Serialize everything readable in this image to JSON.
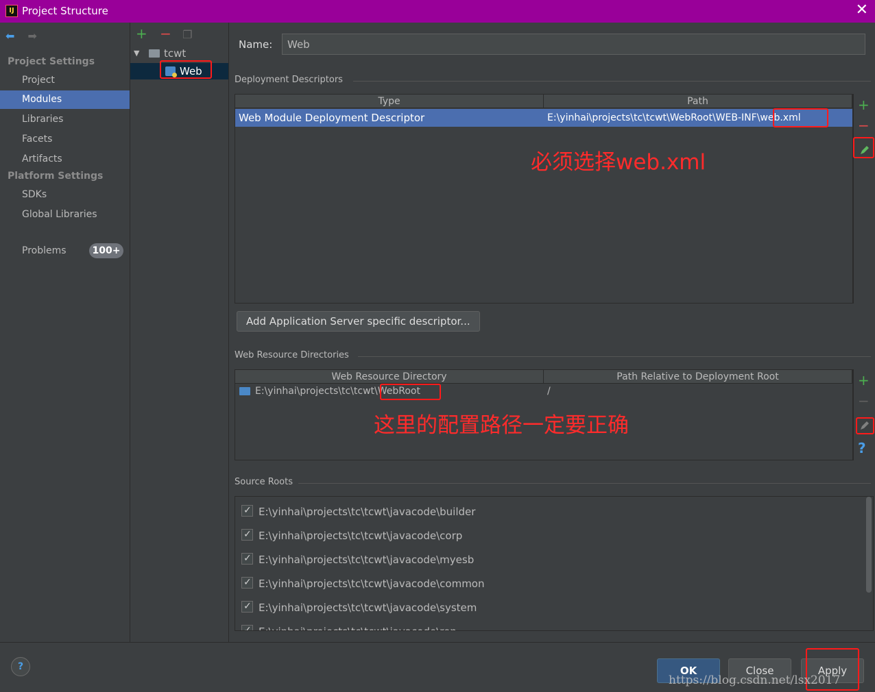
{
  "window": {
    "title": "Project Structure",
    "close": "✕"
  },
  "sidebar": {
    "back": "⬅",
    "forward": "➡",
    "project_settings_label": "Project Settings",
    "project_items": [
      "Project",
      "Modules",
      "Libraries",
      "Facets",
      "Artifacts"
    ],
    "platform_settings_label": "Platform Settings",
    "platform_items": [
      "SDKs",
      "Global Libraries"
    ],
    "problems_label": "Problems",
    "problems_badge": "100+"
  },
  "tree": {
    "root": "tcwt",
    "child": "Web"
  },
  "module": {
    "name_label": "Name:",
    "name_value": "Web",
    "deployment": {
      "title": "Deployment Descriptors",
      "col_type": "Type",
      "col_path": "Path",
      "row_type": "Web Module Deployment Descriptor",
      "row_path": "E:\\yinhai\\projects\\tc\\tcwt\\WebRoot\\WEB-INF\\web.xml",
      "annotation": "必须选择web.xml",
      "add_button": "Add Application Server specific descriptor..."
    },
    "web_resources": {
      "title": "Web Resource Directories",
      "col_dir": "Web Resource Directory",
      "col_rel": "Path Relative to Deployment Root",
      "row_dir": "E:\\yinhai\\projects\\tc\\tcwt\\WebRoot",
      "row_rel": "/",
      "annotation": "这里的配置路径一定要正确",
      "help": "?"
    },
    "source_roots": {
      "title": "Source Roots",
      "items": [
        "E:\\yinhai\\projects\\tc\\tcwt\\javacode\\builder",
        "E:\\yinhai\\projects\\tc\\tcwt\\javacode\\corp",
        "E:\\yinhai\\projects\\tc\\tcwt\\javacode\\myesb",
        "E:\\yinhai\\projects\\tc\\tcwt\\javacode\\common",
        "E:\\yinhai\\projects\\tc\\tcwt\\javacode\\system",
        "E:\\yinhai\\projects\\tc\\tcwt\\javacode\\rep"
      ]
    }
  },
  "footer": {
    "help": "?",
    "ok": "OK",
    "close": "Close",
    "apply": "Apply",
    "watermark": "https://blog.csdn.net/lsx2017"
  }
}
